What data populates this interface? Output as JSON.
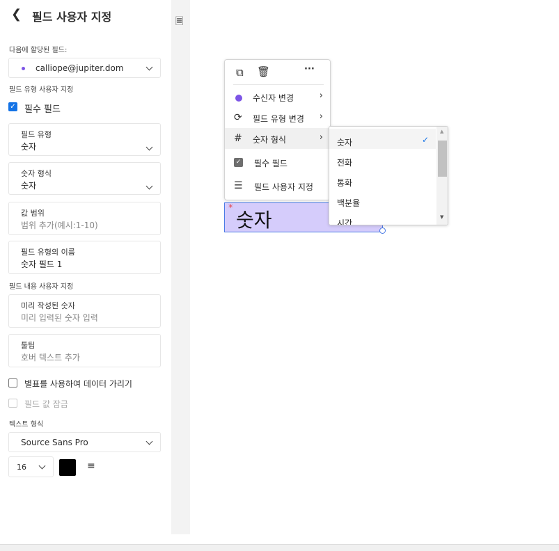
{
  "sidebar": {
    "title": "필드 사용자 지정",
    "assigned_label": "다음에 할당된 필드:",
    "assignee": "calliope@jupiter.dom",
    "assignee_color": "#7d55e6",
    "type_section": "필드 유형 사용자 지정",
    "required_label": "필수 필드",
    "required_checked": true,
    "field_type": {
      "label": "필드 유형",
      "value": "숫자"
    },
    "number_format": {
      "label": "숫자 형식",
      "value": "숫자"
    },
    "range": {
      "label": "값 범위",
      "placeholder": "범위 추가(예시:1-10)"
    },
    "type_name": {
      "label": "필드 유형의 이름",
      "value": "숫자 필드 1"
    },
    "content_section": "필드 내용 사용자 지정",
    "prefilled": {
      "label": "미리 작성된 숫자",
      "placeholder": "미리 입력된 숫자 입력"
    },
    "tooltip": {
      "label": "툴팁",
      "placeholder": "호버 텍스트 추가"
    },
    "mask_label": "별표를 사용하여 데이터 가리기",
    "lock_label": "필드 값 잠금",
    "text_format_section": "텍스트 형식",
    "font": "Source Sans Pro",
    "font_size": "16",
    "text_color": "#000000"
  },
  "context_menu": {
    "items": [
      {
        "label": "수신자 변경"
      },
      {
        "label": "필드 유형 변경"
      },
      {
        "label": "숫자 형식"
      },
      {
        "label": "필수 필드"
      },
      {
        "label": "필드 사용자 지정"
      }
    ]
  },
  "submenu": {
    "options": [
      "숫자",
      "전화",
      "통화",
      "백분율",
      "시간"
    ],
    "selected": "숫자"
  },
  "canvas_field": {
    "text": "숫자",
    "required_mark": "*"
  }
}
